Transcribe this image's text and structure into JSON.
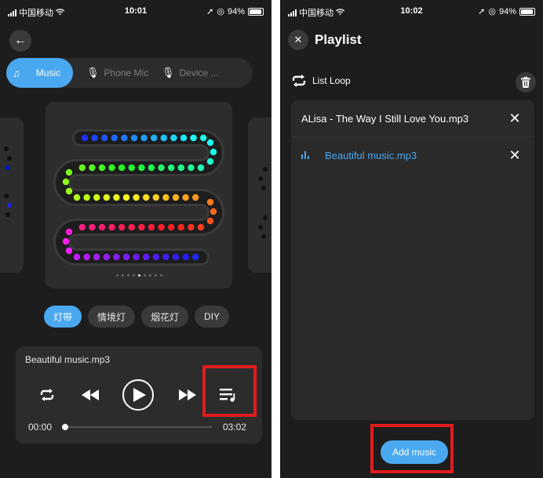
{
  "left": {
    "status": {
      "carrier": "中国移动",
      "time": "10:01",
      "battery": "94%"
    },
    "source_tabs": [
      {
        "label": "Music",
        "active": true
      },
      {
        "label": "Phone Mic",
        "active": false
      },
      {
        "label": "Device ...",
        "active": false
      }
    ],
    "categories": [
      {
        "label": "灯带",
        "active": true
      },
      {
        "label": "情境灯",
        "active": false
      },
      {
        "label": "烟花灯",
        "active": false
      },
      {
        "label": "DIY",
        "active": false
      }
    ],
    "pattern_page": {
      "count": 9,
      "current": 5
    },
    "player": {
      "song": "Beautiful music.mp3",
      "current_time": "00:00",
      "duration": "03:02",
      "progress": 0
    }
  },
  "right": {
    "status": {
      "carrier": "中国移动",
      "time": "10:02",
      "battery": "94%"
    },
    "title": "Playlist",
    "loop_mode": "List Loop",
    "items": [
      {
        "name": "ALisa - The Way I Still Love You.mp3",
        "playing": false
      },
      {
        "name": "Beautiful music.mp3",
        "playing": true
      }
    ],
    "add_button": "Add music"
  },
  "colors": {
    "accent": "#4aa8f0",
    "highlight_box": "#e21b1b",
    "background": "#1d1d1d",
    "card": "#2c2c2c"
  }
}
